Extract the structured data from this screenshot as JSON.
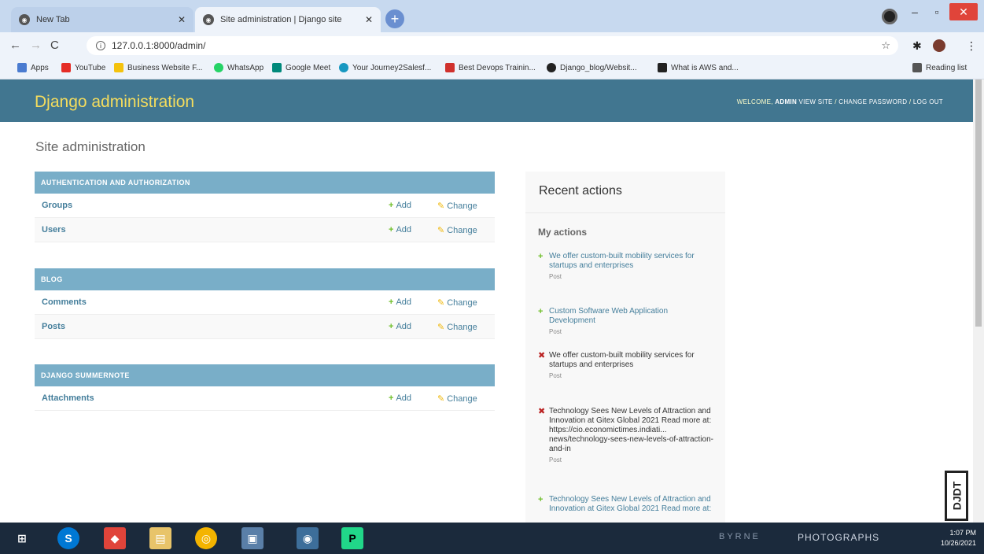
{
  "browser": {
    "tabs": [
      {
        "title": "New Tab"
      },
      {
        "title": "Site administration | Django site"
      }
    ],
    "url": "127.0.0.1:8000/admin/",
    "bookmarks": [
      "Apps",
      "YouTube",
      "Business Website F...",
      "WhatsApp",
      "Google Meet",
      "Your Journey2Salesf...",
      "Best Devops Trainin...",
      "Django_blog/Websit...",
      "What is AWS and...",
      "Reading list"
    ]
  },
  "header": {
    "branding": "Django administration",
    "welcome": "WELCOME,",
    "username": "ADMIN",
    "view_site": "VIEW SITE",
    "change_password": "CHANGE PASSWORD",
    "log_out": "LOG OUT",
    "sep": " / "
  },
  "content": {
    "title": "Site administration",
    "add_label": "Add",
    "change_label": "Change",
    "modules": [
      {
        "caption": "Authentication and Authorization",
        "models": [
          "Groups",
          "Users"
        ]
      },
      {
        "caption": "Blog",
        "models": [
          "Comments",
          "Posts"
        ]
      },
      {
        "caption": "Django Summernote",
        "models": [
          "Attachments"
        ]
      }
    ]
  },
  "recent": {
    "title": "Recent actions",
    "subtitle": "My actions",
    "actions": [
      {
        "kind": "add",
        "text": "We offer custom-built mobility services for startups and enterprises",
        "type": "Post"
      },
      {
        "kind": "add",
        "text": "Custom Software Web Application Development",
        "type": "Post"
      },
      {
        "kind": "delete",
        "text": "We offer custom-built mobility services for startups and enterprises",
        "type": "Post"
      },
      {
        "kind": "delete",
        "text": "Technology Sees New Levels of Attraction and Innovation at Gitex Global 2021 Read more at: https://cio.economictimes.indiati... news/technology-sees-new-levels-of-attraction-and-in",
        "type": "Post"
      },
      {
        "kind": "add",
        "text": "Technology Sees New Levels of Attraction and Innovation at Gitex Global 2021 Read more at:",
        "type": ""
      }
    ]
  },
  "djdt": "DJDT",
  "taskbar": {
    "time": "1:07 PM",
    "date": "10/26/2021",
    "watermark": "PHOTOGRAPHS",
    "watermark2": "BYRNE"
  }
}
